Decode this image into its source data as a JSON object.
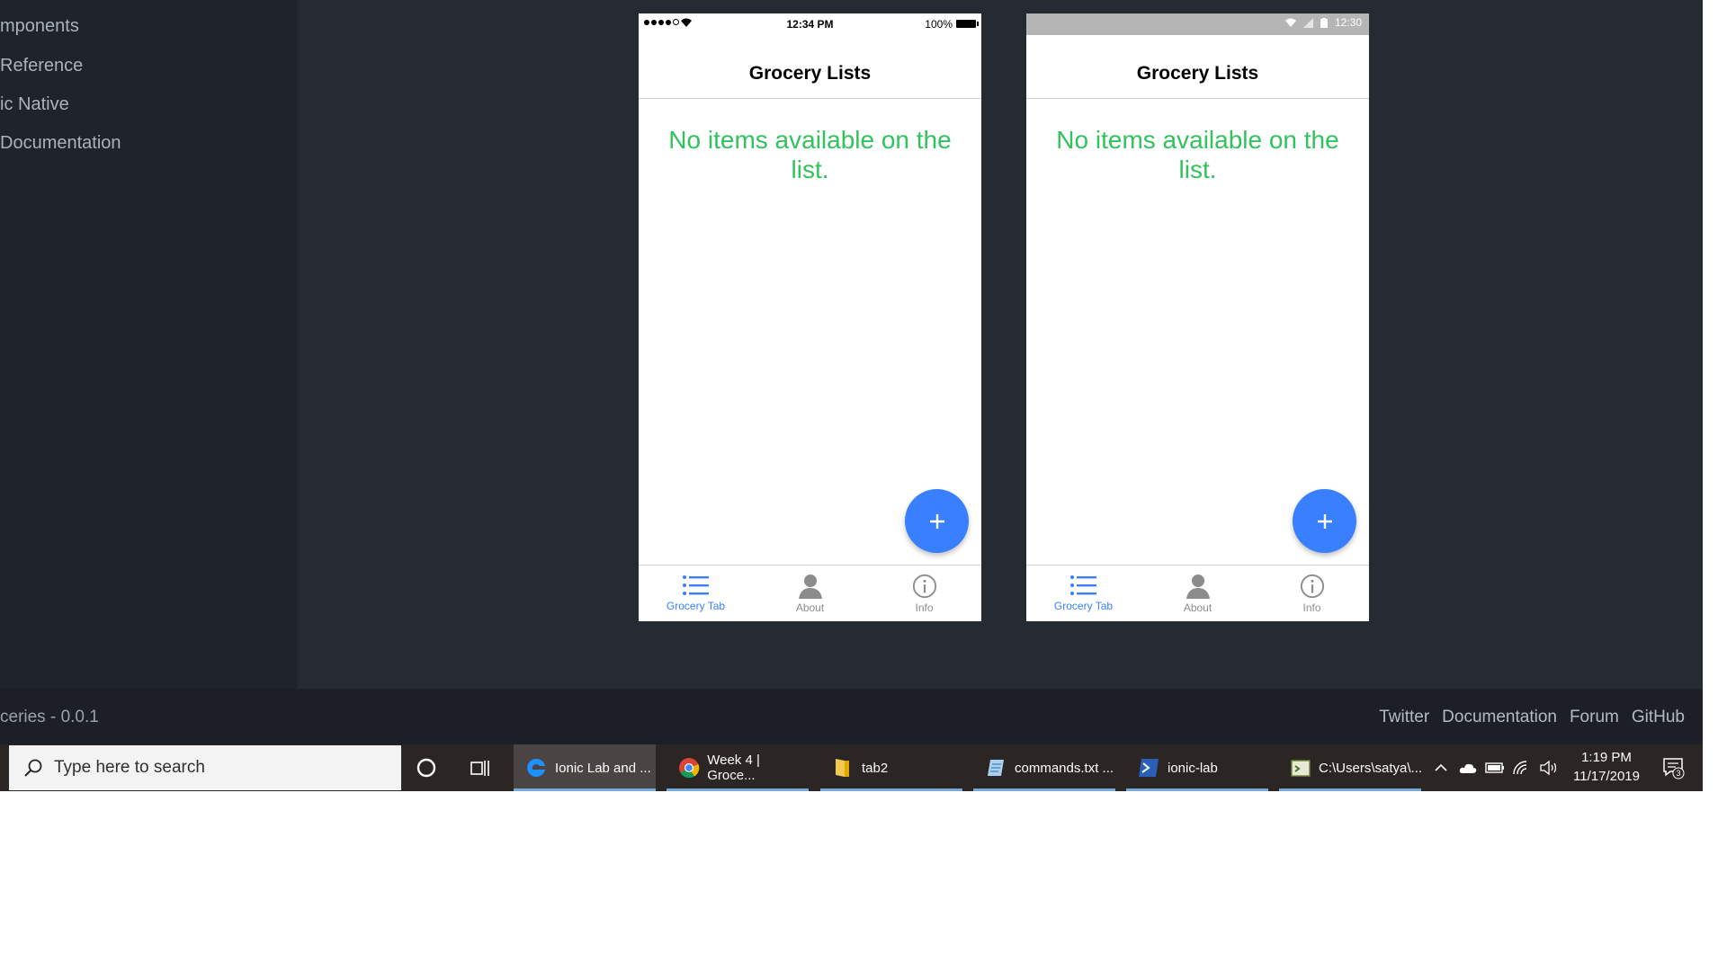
{
  "sidebar": {
    "items": [
      {
        "label": "mponents"
      },
      {
        "label": " Reference"
      },
      {
        "label": "ic Native"
      },
      {
        "label": "Documentation"
      }
    ]
  },
  "phones": {
    "ios": {
      "status_time": "12:34 PM",
      "battery": "100%",
      "title": "Grocery Lists",
      "empty_message": "No items available on the list.",
      "fab_symbol": "+",
      "tabs": [
        {
          "label": "Grocery Tab",
          "icon": "list-icon",
          "active": true
        },
        {
          "label": "About",
          "icon": "person-icon",
          "active": false
        },
        {
          "label": "Info",
          "icon": "info-icon",
          "active": false
        }
      ]
    },
    "android": {
      "status_time": "12:30",
      "title": "Grocery Lists",
      "empty_message": "No items available on the list.",
      "fab_symbol": "+",
      "tabs": [
        {
          "label": "Grocery Tab",
          "icon": "list-icon",
          "active": true
        },
        {
          "label": "About",
          "icon": "person-icon",
          "active": false
        },
        {
          "label": "Info",
          "icon": "info-icon",
          "active": false
        }
      ]
    }
  },
  "footer": {
    "version": "ceries - 0.0.1",
    "links": [
      "Twitter",
      "Documentation",
      "Forum",
      "GitHub"
    ]
  },
  "taskbar": {
    "search_placeholder": "Type here to search",
    "apps": [
      {
        "label": "Ionic Lab and ...",
        "icon": "edge-icon",
        "active": true
      },
      {
        "label": "Week 4 | Groce...",
        "icon": "chrome-icon",
        "active": false
      },
      {
        "label": "tab2",
        "icon": "folder-icon",
        "active": false
      },
      {
        "label": "commands.txt ...",
        "icon": "notepad-icon",
        "active": false
      },
      {
        "label": "ionic-lab",
        "icon": "powershell-icon",
        "active": false
      },
      {
        "label": "C:\\Users\\satya\\...",
        "icon": "terminal-icon",
        "active": false
      }
    ],
    "time": "1:19 PM",
    "date": "11/17/2019",
    "notification_count": "3"
  },
  "colors": {
    "accent": "#3880ff",
    "empty_text": "#32c25e",
    "app_bg": "#262b33",
    "sidebar_bg": "#1f232a",
    "taskbar_bg": "#2b2523"
  }
}
